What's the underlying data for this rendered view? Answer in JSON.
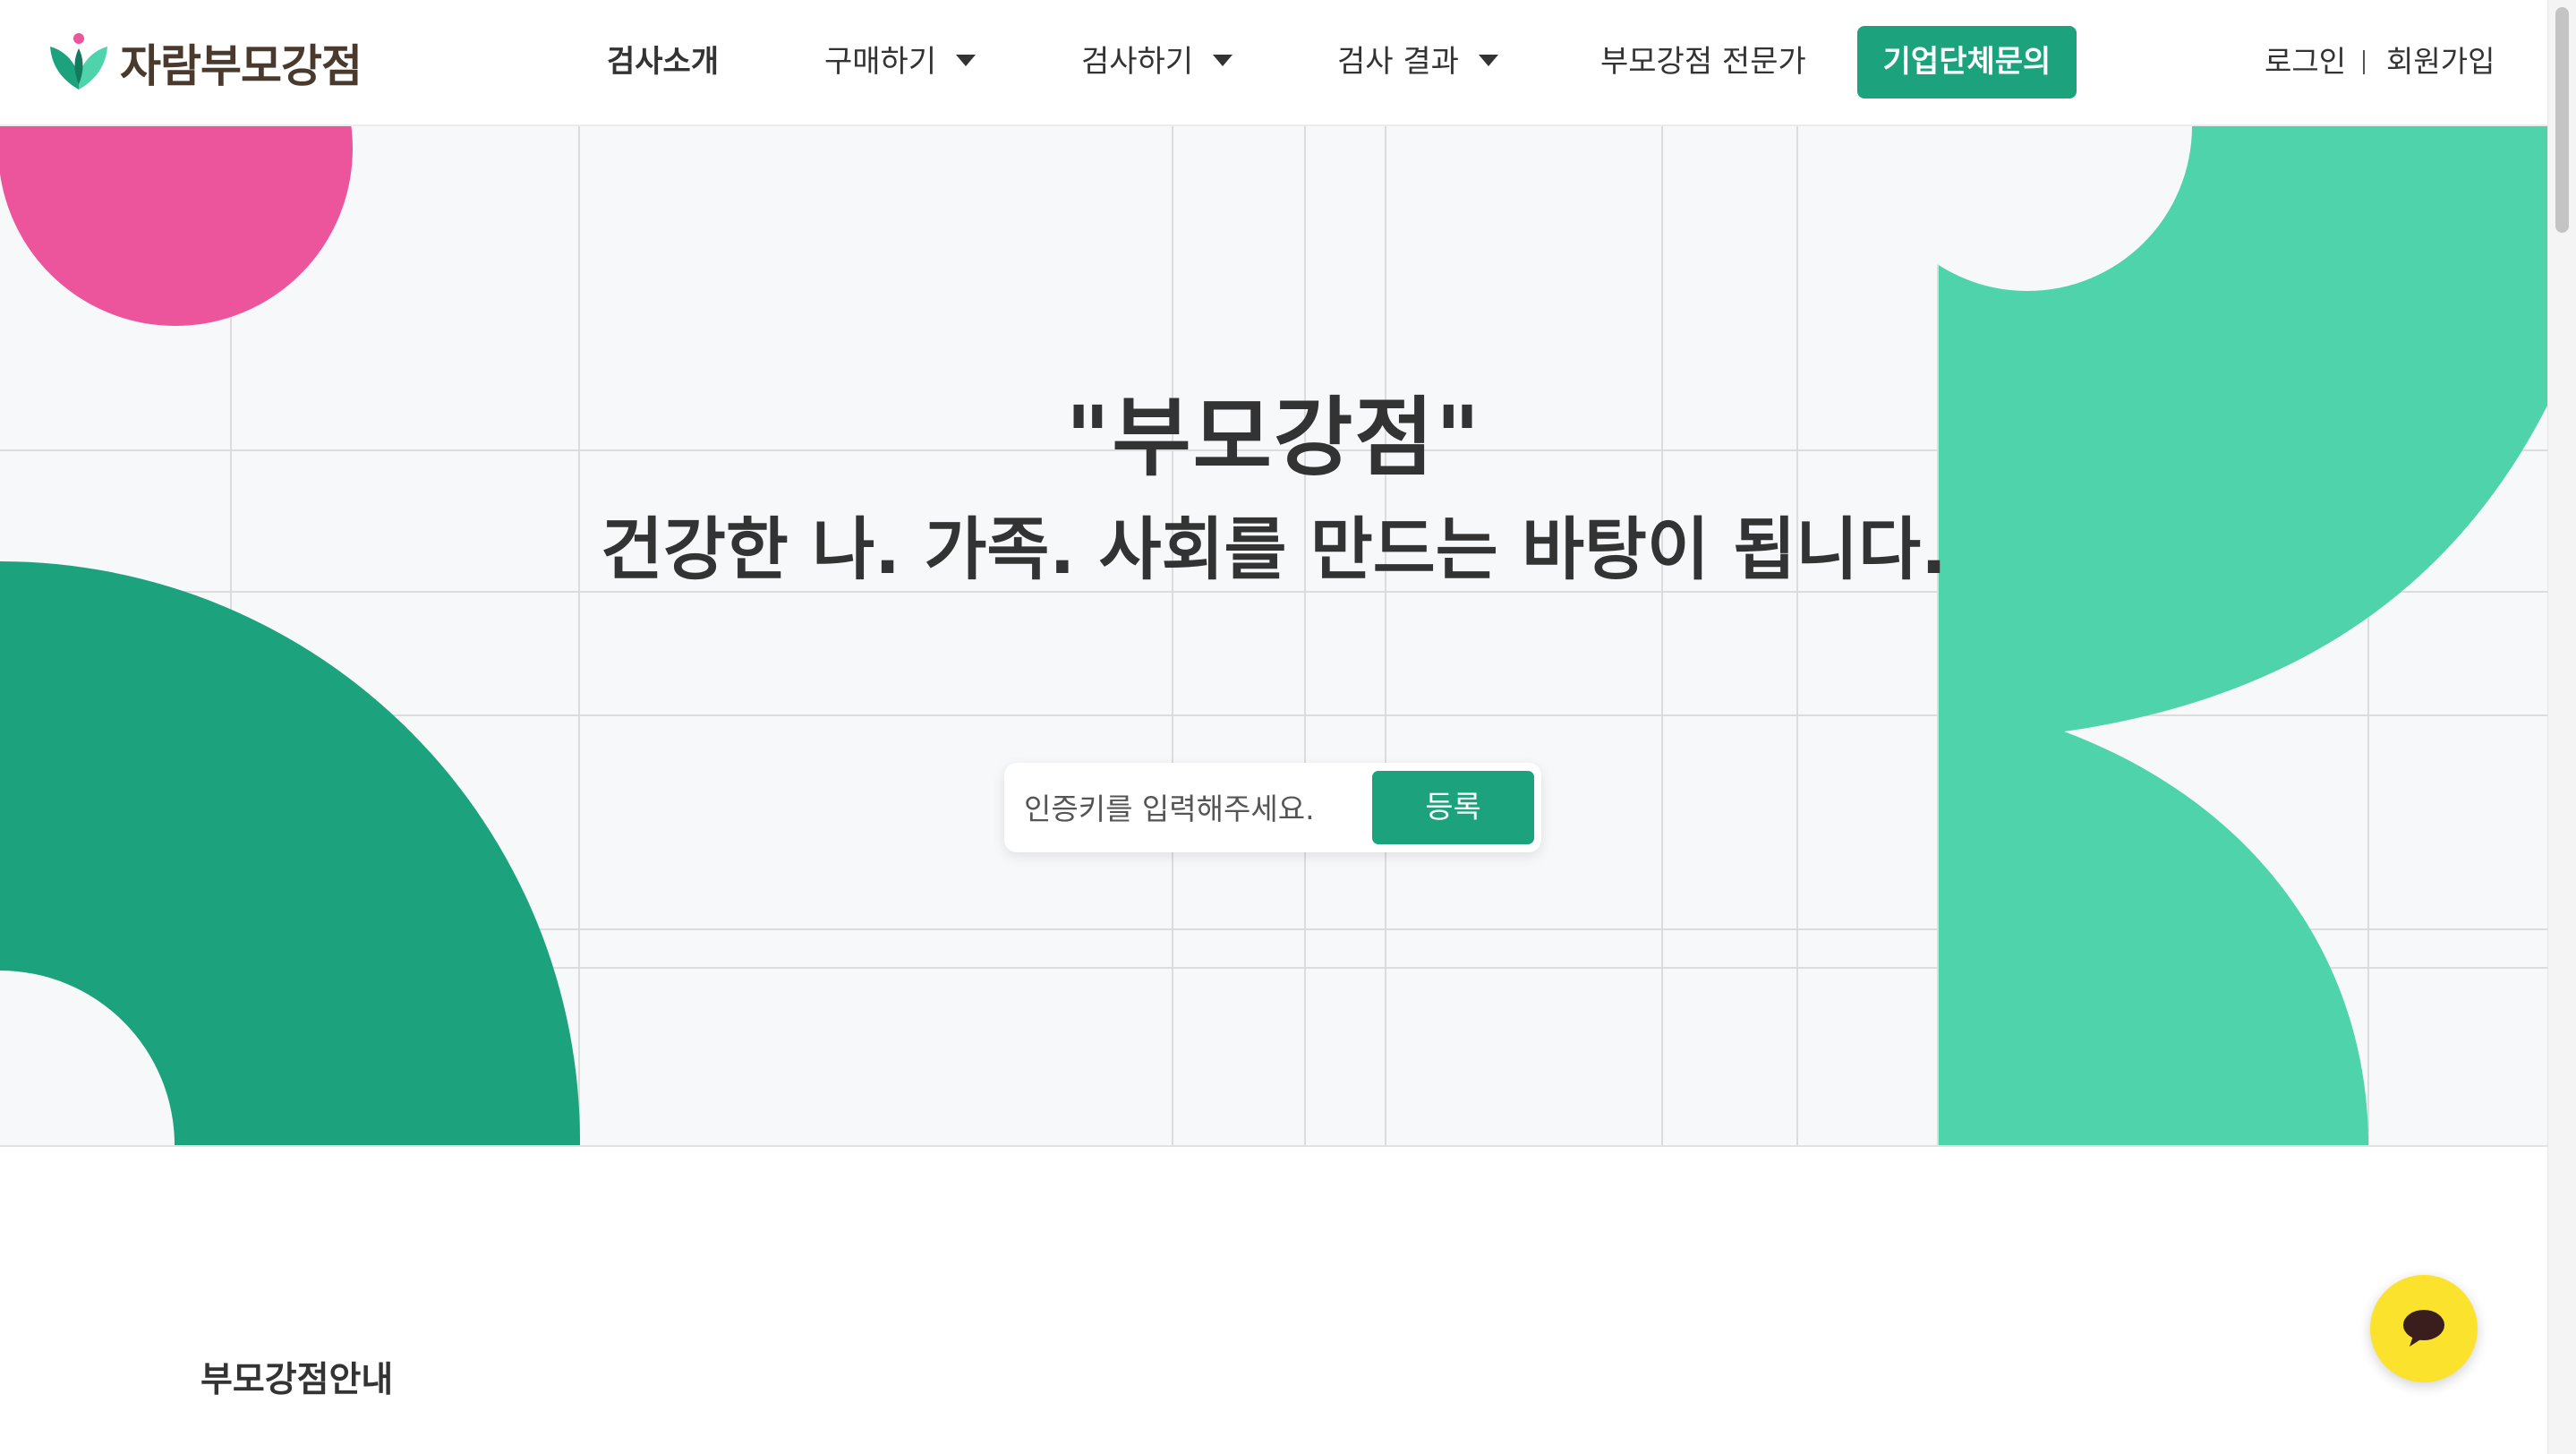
{
  "header": {
    "logo_text": "자람부모강점",
    "nav": [
      {
        "label": "검사소개",
        "has_dropdown": false
      },
      {
        "label": "구매하기",
        "has_dropdown": true
      },
      {
        "label": "검사하기",
        "has_dropdown": true
      },
      {
        "label": "검사 결과",
        "has_dropdown": true
      },
      {
        "label": "부모강점 전문가",
        "has_dropdown": false
      }
    ],
    "cta_label": "기업단체문의",
    "login_label": "로그인",
    "signup_label": "회원가입"
  },
  "hero": {
    "title": "\"부모강점\"",
    "subtitle": "건강한 나. 가족. 사회를 만드는 바탕이 됩니다.",
    "input_placeholder": "인증키를 입력해주세요.",
    "register_label": "등록"
  },
  "section": {
    "label": "부모강점안내"
  },
  "icons": {
    "logo": "sprout-logo-icon",
    "caret": "caret-down-icon",
    "chat": "chat-bubble-icon"
  },
  "colors": {
    "brand_green": "#1ca37e",
    "mint": "#4fd3aa",
    "pink": "#ec549c",
    "hero_bg": "#f7f8fa",
    "chat_yellow": "#fae22d",
    "logo_text": "#4a3a2e"
  }
}
